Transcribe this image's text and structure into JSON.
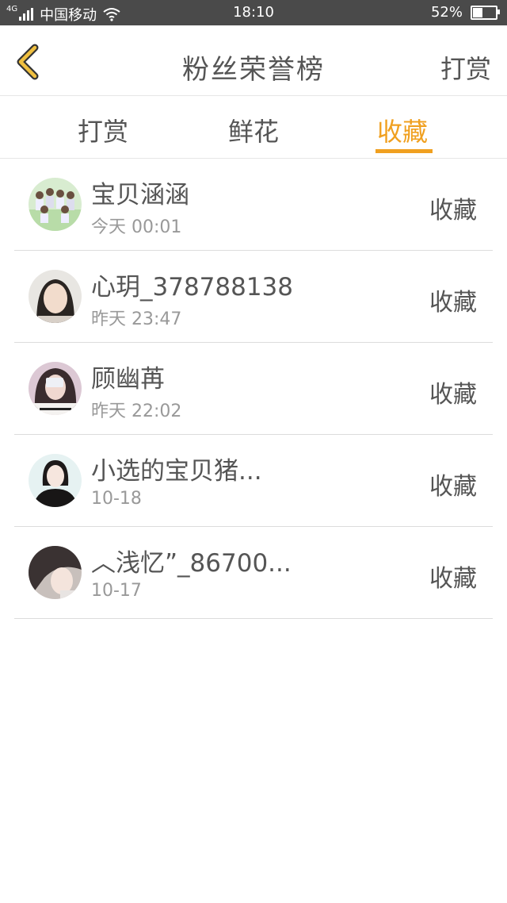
{
  "statusbar": {
    "network": "4G",
    "carrier": "中国移动",
    "time": "18:10",
    "battery": "52%",
    "battery_level": 0.52
  },
  "header": {
    "title": "粉丝荣誉榜",
    "action": "打赏",
    "back_icon": "chevron-left-icon",
    "back_color": "#f0c040"
  },
  "tabs": [
    {
      "label": "打赏",
      "active": false
    },
    {
      "label": "鲜花",
      "active": false
    },
    {
      "label": "收藏",
      "active": true
    }
  ],
  "accent_color": "#f0a020",
  "list": [
    {
      "name": "宝贝涵涵",
      "time": "今天 00:01",
      "action": "收藏"
    },
    {
      "name": "心玥_378788138",
      "time": "昨天 23:47",
      "action": "收藏"
    },
    {
      "name": "顾幽苒",
      "time": "昨天 22:02",
      "action": "收藏"
    },
    {
      "name": "小选的宝贝猪...",
      "time": "10-18",
      "action": "收藏"
    },
    {
      "name": "︿浅忆”_86700...",
      "time": "10-17",
      "action": "收藏"
    }
  ]
}
